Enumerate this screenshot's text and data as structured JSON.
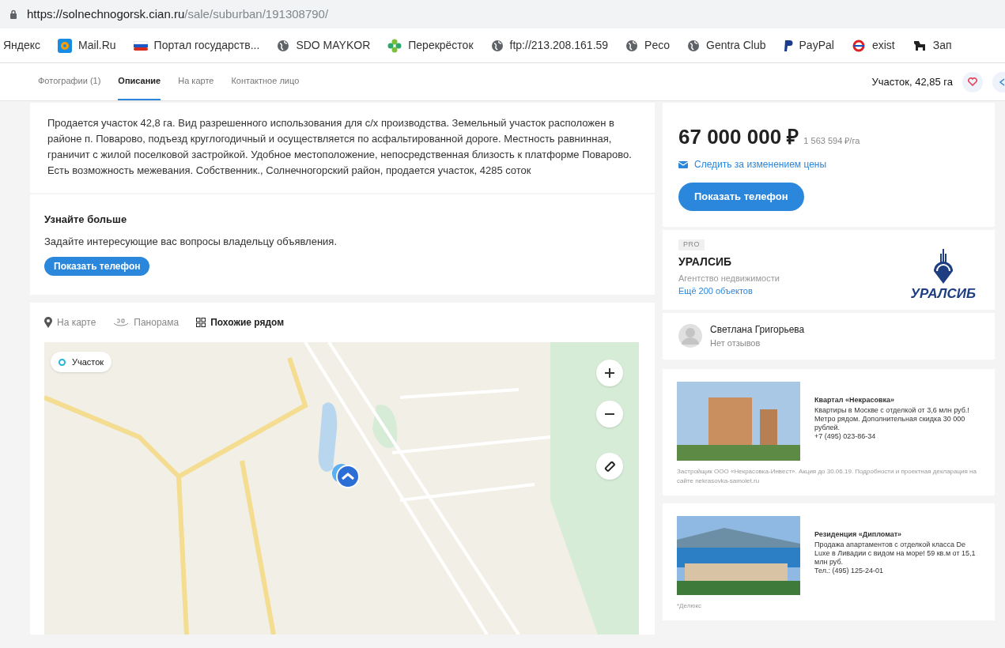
{
  "browser": {
    "url_host": "https://solnechnogorsk.cian.ru",
    "url_path": "/sale/suburban/191308790/"
  },
  "bookmarks": [
    {
      "label": "Яндекс",
      "kind": "none"
    },
    {
      "label": "Mail.Ru",
      "kind": "mail"
    },
    {
      "label": "Портал государств...",
      "kind": "flag"
    },
    {
      "label": "SDO MAYKOR",
      "kind": "globe"
    },
    {
      "label": "Перекрёсток",
      "kind": "clover"
    },
    {
      "label": "ftp://213.208.161.59",
      "kind": "globe"
    },
    {
      "label": "Peco",
      "kind": "globe"
    },
    {
      "label": "Gentra Club",
      "kind": "globe"
    },
    {
      "label": "PayPal",
      "kind": "paypal"
    },
    {
      "label": "exist",
      "kind": "exist"
    },
    {
      "label": "Зап",
      "kind": "dog"
    }
  ],
  "nav": {
    "tabs": [
      {
        "label": "Фотографии (1)",
        "selected": false
      },
      {
        "label": "Описание",
        "selected": true
      },
      {
        "label": "На карте",
        "selected": false
      },
      {
        "label": "Контактное лицо",
        "selected": false
      }
    ],
    "title": "Участок, 42,85 га"
  },
  "description": "Продается участок 42,8 га. Вид разрешенного использования для с/х производства. Земельный участок расположен в районе п. Поварово, подъезд круглогодичный и осуществляется по асфальтированной дороге. Местность равнинная, граничит с жилой поселковой застройкой. Удобное местоположение, непосредственная близость к платформе Поварово. Есть возможность межевания. Собственник., Солнечногорский район, продается участок, 4285 соток",
  "learn_more": {
    "title": "Узнайте больше",
    "text": "Задайте интересующие вас вопросы владельцу объявления.",
    "button": "Показать телефон"
  },
  "map": {
    "tabs": [
      {
        "label": "На карте",
        "kind": "pin",
        "selected": false
      },
      {
        "label": "Панорама",
        "kind": "panorama",
        "selected": false
      },
      {
        "label": "Похожие рядом",
        "kind": "grid",
        "selected": true
      }
    ],
    "chip": "Участок"
  },
  "price": {
    "amount": "67 000 000 ₽",
    "per_unit": "1 563 594 ₽/га",
    "watch": "Следить за изменением цены",
    "button": "Показать телефон"
  },
  "agency": {
    "badge": "PRO",
    "name": "УРАЛСИБ",
    "type": "Агентство недвижимости",
    "link": "Ещё 200 объектов",
    "logo_text": "УРАЛСИБ"
  },
  "contact": {
    "name": "Светлана Григорьева",
    "reviews": "Нет отзывов"
  },
  "ads": [
    {
      "kind": "towers",
      "title": "Квартал «Некрасовка»",
      "text": "Квартиры в Москве с отделкой от 3,6 млн руб.! Метро рядом. Дополнительная скидка 30 000 рублей.",
      "phone": "+7 (495) 023-86-34",
      "footnote": "Застройщик ООО «Некрасовка-Инвест». Акция до 30.06.19. Подробности и проектная декларация на сайте nekrasovka-samolet.ru"
    },
    {
      "kind": "sea",
      "title": "Резиденция «Дипломат»",
      "text": "Продажа апартаментов с отделкой класса De Luxe в Ливадии с видом на море! 59 кв.м от 15,1 млн руб.",
      "phone": "Тел.: (495) 125-24-01",
      "footnote": "*Делюкс"
    }
  ]
}
